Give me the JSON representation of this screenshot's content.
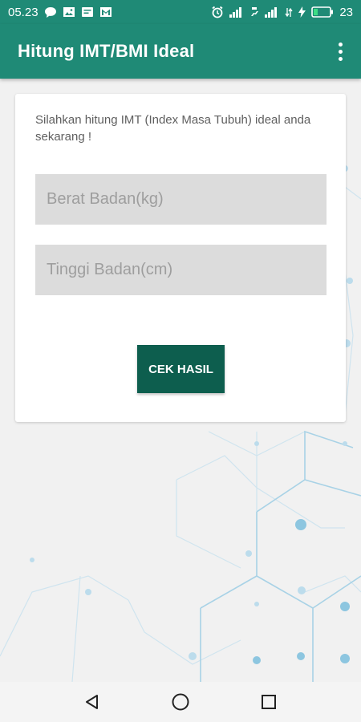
{
  "status_bar": {
    "time": "05.23",
    "battery": "23",
    "icons": [
      "chat-icon",
      "image-icon",
      "message-icon",
      "gmail-icon",
      "alarm-icon",
      "signal-icon",
      "signal-4g-icon",
      "signal-icon",
      "data-icon",
      "charging-icon",
      "battery-icon"
    ]
  },
  "app_bar": {
    "title": "Hitung IMT/BMI Ideal",
    "menu_icon": "more-vert-icon"
  },
  "form": {
    "intro": "Silahkan hitung IMT (Index Masa Tubuh) ideal anda sekarang !",
    "weight_placeholder": "Berat Badan(kg)",
    "height_placeholder": "Tinggi Badan(cm)",
    "submit_label": "CEK HASIL"
  },
  "nav_bar": {
    "icons": [
      "back-icon",
      "home-icon",
      "recents-icon"
    ]
  },
  "colors": {
    "primary": "#1f8a76",
    "button": "#0d5e4e",
    "field": "#dcdcdc",
    "background": "#f1f1f1"
  }
}
